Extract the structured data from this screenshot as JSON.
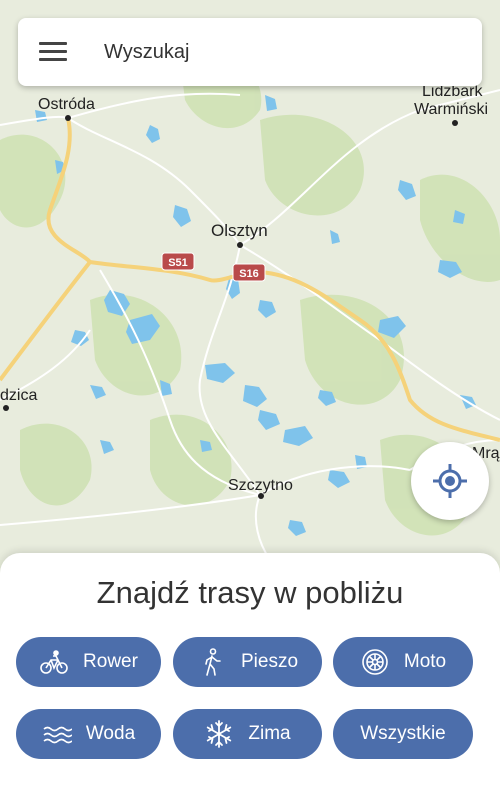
{
  "search": {
    "placeholder": "Wyszukaj"
  },
  "map": {
    "places": [
      {
        "name": "Ostróda"
      },
      {
        "name": "Lidzbark"
      },
      {
        "name": "Warmiński"
      },
      {
        "name": "Olsztyn"
      },
      {
        "name": "Szczytno"
      },
      {
        "name": "dzica"
      },
      {
        "name": "Mrąg"
      }
    ],
    "roads": [
      {
        "ref": "S51"
      },
      {
        "ref": "S16"
      }
    ]
  },
  "sheet": {
    "title": "Znajdź trasy w pobliżu",
    "categories": [
      {
        "label": "Rower",
        "icon": "bicycle-icon"
      },
      {
        "label": "Pieszo",
        "icon": "walking-icon"
      },
      {
        "label": "Moto",
        "icon": "wheel-icon"
      },
      {
        "label": "Woda",
        "icon": "waves-icon"
      },
      {
        "label": "Zima",
        "icon": "snowflake-icon"
      },
      {
        "label": "Wszystkie",
        "icon": ""
      }
    ]
  },
  "colors": {
    "accent": "#4c6eab",
    "map_land": "#e6ecd9",
    "water": "#7fc3eb",
    "forest": "#cfe2b4"
  }
}
